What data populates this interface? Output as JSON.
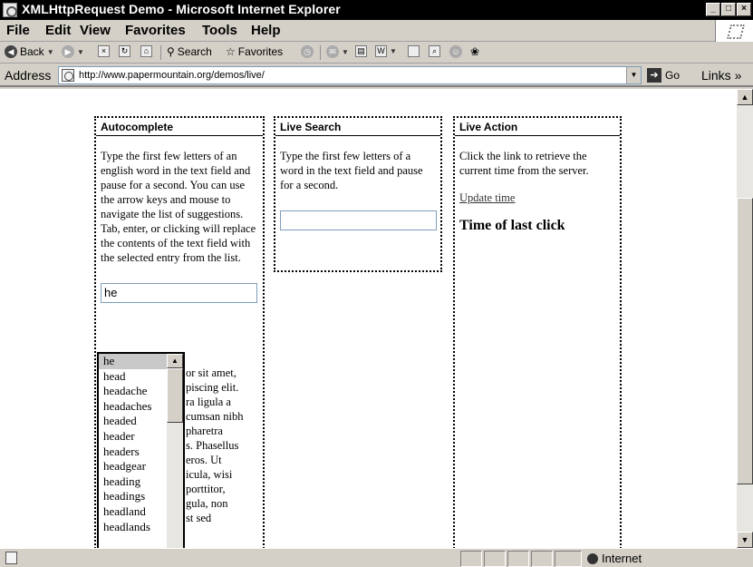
{
  "window": {
    "title": "XMLHttpRequest Demo - Microsoft Internet Explorer",
    "buttons": [
      "_",
      "□",
      "×"
    ]
  },
  "menu": [
    "File",
    "Edit",
    "View",
    "Favorites",
    "Tools",
    "Help"
  ],
  "toolbar": {
    "back": "Back",
    "search": "Search",
    "favorites": "Favorites"
  },
  "address": {
    "label": "Address",
    "url": "http://www.papermountain.org/demos/live/",
    "go": "Go",
    "links": "Links »"
  },
  "autocomplete": {
    "title": "Autocomplete",
    "description": "Type the first few letters of an english word in the text field and pause for a second. You can use the arrow keys and mouse to navigate the list of suggestions. Tab, enter, or clicking will replace the contents of the text field with the selected entry from the list.",
    "input_value": "he",
    "suggestions": [
      "he",
      "head",
      "headache",
      "headaches",
      "headed",
      "header",
      "headers",
      "headgear",
      "heading",
      "headings",
      "headland",
      "headlands"
    ],
    "lorem_lines": [
      "or sit amet,",
      "piscing elit.",
      "ra ligula a",
      "cumsan nibh",
      "pharetra",
      "s. Phasellus",
      "eros. Ut",
      "icula, wisi",
      "porttitor,",
      "gula, non",
      "st sed",
      ""
    ]
  },
  "live_search": {
    "title": "Live Search",
    "description": "Type the first few letters of a word in the text field and pause for a second.",
    "input_value": ""
  },
  "live_action": {
    "title": "Live Action",
    "description": "Click the link to retrieve the current time from the server.",
    "link": "Update time",
    "heading": "Time of last click"
  },
  "status": {
    "zone": "Internet"
  }
}
